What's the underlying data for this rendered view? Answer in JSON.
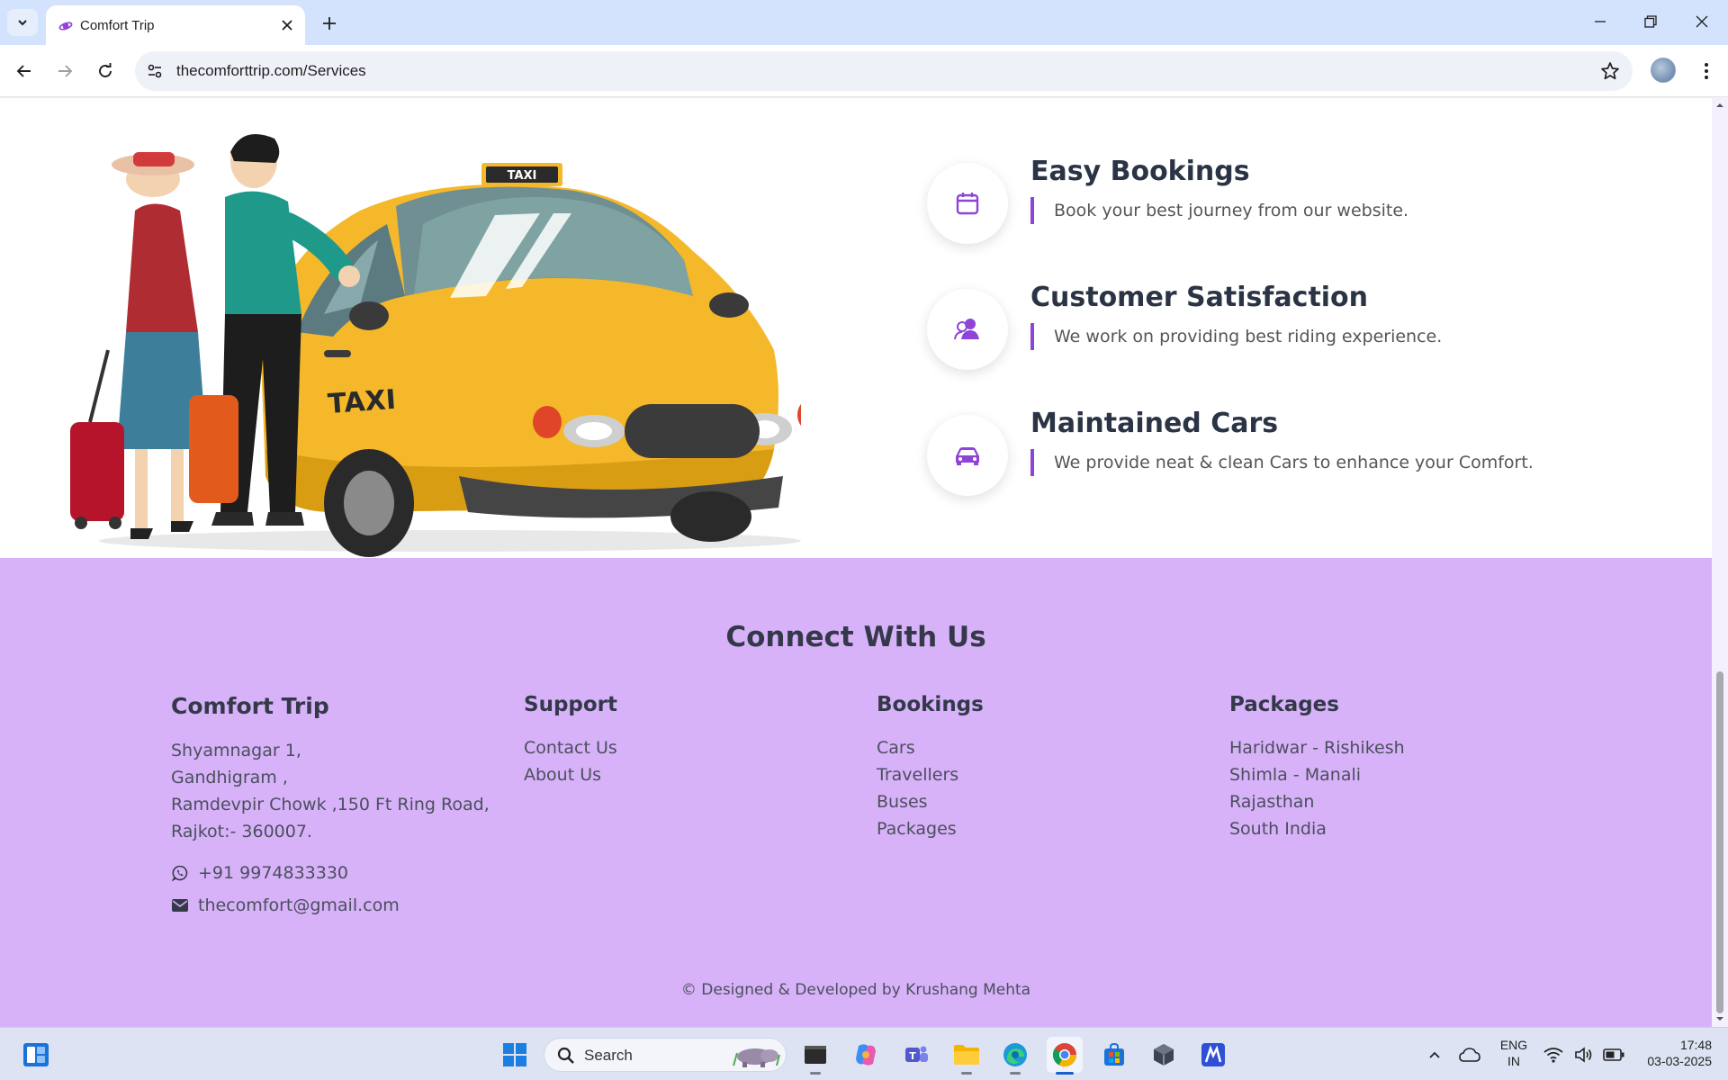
{
  "browser": {
    "tab_title": "Comfort Trip",
    "url": "thecomforttrip.com/Services"
  },
  "features": [
    {
      "icon": "calendar-icon",
      "title": "Easy Bookings",
      "desc": "Book your best journey from our website."
    },
    {
      "icon": "users-icon",
      "title": "Customer Satisfaction",
      "desc": "We work on providing best riding experience."
    },
    {
      "icon": "car-icon",
      "title": "Maintained Cars",
      "desc": "We provide neat & clean Cars to enhance your Comfort."
    }
  ],
  "illustration": {
    "taxi_sign": "TAXI",
    "door_text": "TAXI"
  },
  "footer": {
    "title": "Connect With Us",
    "brand": {
      "name": "Comfort Trip",
      "address": [
        "Shyamnagar 1,",
        "Gandhigram ,",
        "Ramdevpir Chowk ,150 Ft Ring Road,",
        "Rajkot:- 360007."
      ],
      "phone": "+91 9974833330",
      "email": "thecomfort@gmail.com"
    },
    "support": {
      "title": "Support",
      "links": [
        "Contact Us",
        "About Us"
      ]
    },
    "bookings": {
      "title": "Bookings",
      "links": [
        "Cars",
        "Travellers",
        "Buses",
        "Packages"
      ]
    },
    "packages": {
      "title": "Packages",
      "links": [
        "Haridwar - Rishikesh",
        "Shimla - Manali",
        "Rajasthan",
        "South India"
      ]
    },
    "copyright": "© Designed & Developed by Krushang Mehta"
  },
  "taskbar": {
    "search_label": "Search",
    "lang_line1": "ENG",
    "lang_line2": "IN",
    "time": "17:48",
    "date": "03-03-2025"
  },
  "colors": {
    "accent": "#8e44d6",
    "footer_bg": "#d7b2f9",
    "tab_bar": "#d3e3fd"
  }
}
